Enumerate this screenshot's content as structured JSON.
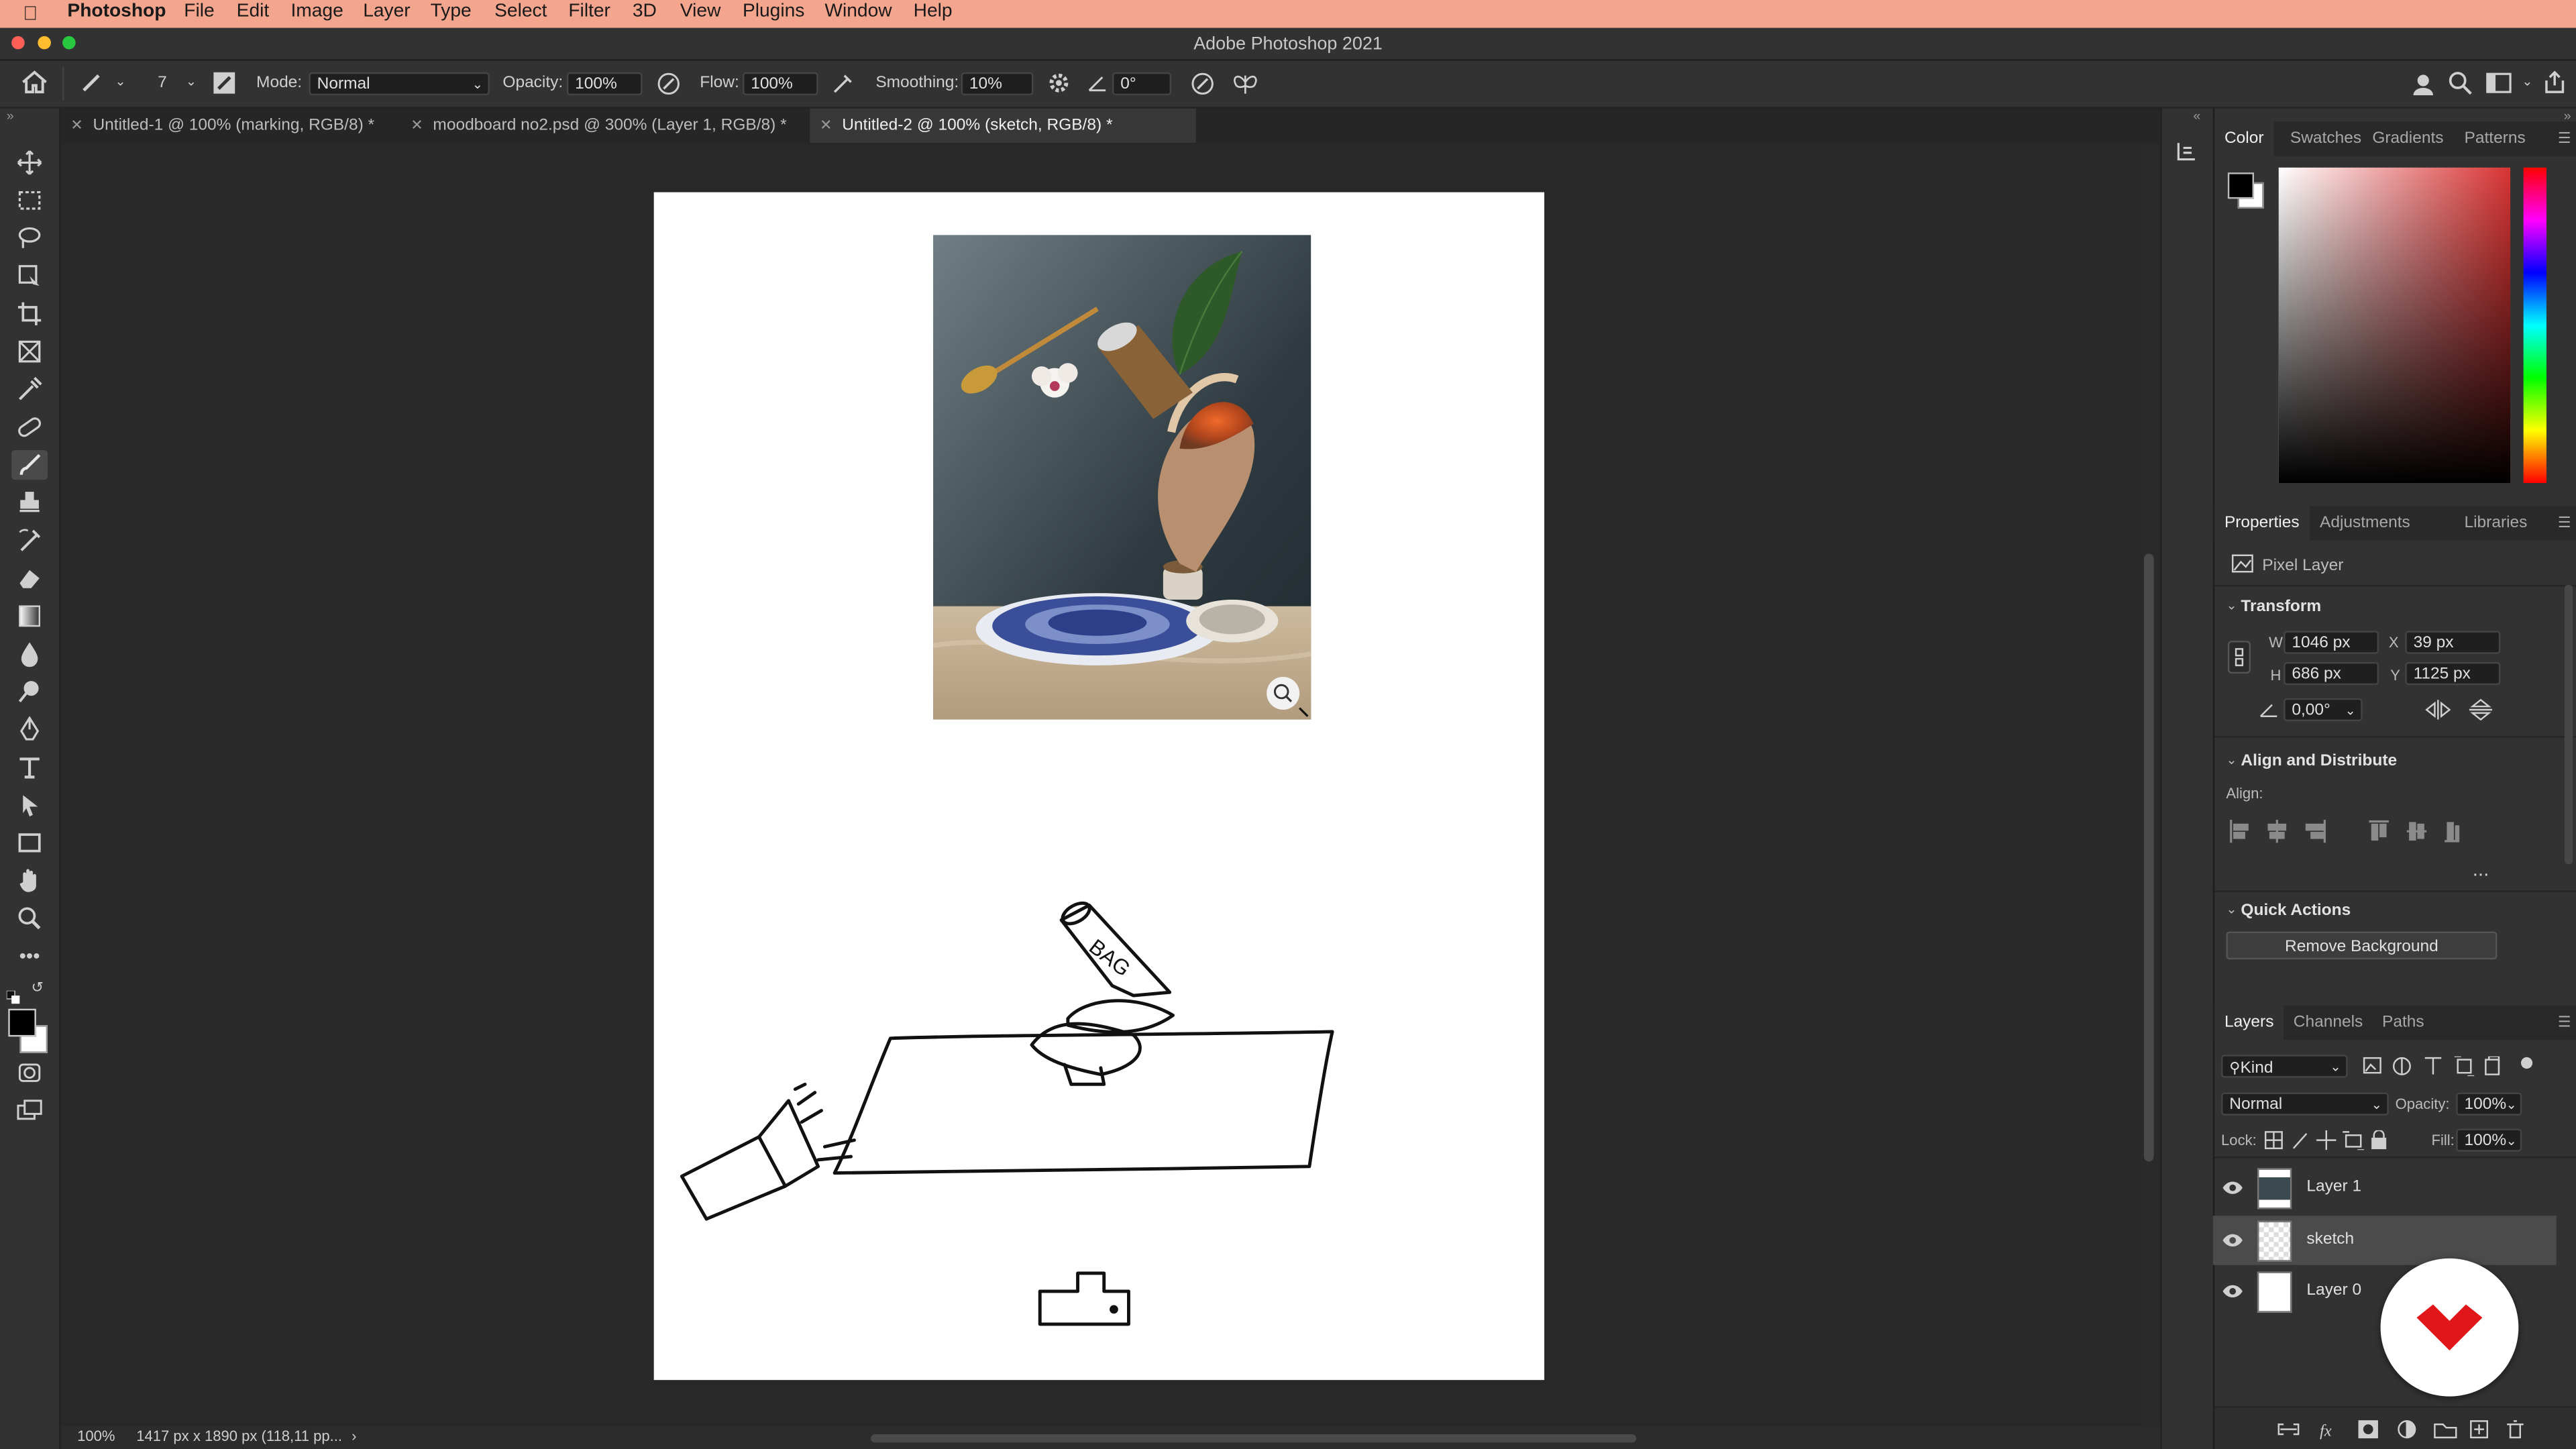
{
  "menubar": {
    "app": "Photoshop",
    "items": [
      "File",
      "Edit",
      "Image",
      "Layer",
      "Type",
      "Select",
      "Filter",
      "3D",
      "View",
      "Plugins",
      "Window",
      "Help"
    ]
  },
  "window": {
    "title": "Adobe Photoshop 2021"
  },
  "options": {
    "brush_size": "7",
    "mode_label": "Mode:",
    "mode_value": "Normal",
    "opacity_label": "Opacity:",
    "opacity_value": "100%",
    "flow_label": "Flow:",
    "flow_value": "100%",
    "smoothing_label": "Smoothing:",
    "smoothing_value": "10%",
    "angle_value": "0°"
  },
  "tabs": [
    {
      "label": "Untitled-1 @ 100% (marking, RGB/8) *"
    },
    {
      "label": "moodboard no2.psd @ 300% (Layer 1, RGB/8) *"
    },
    {
      "label": "Untitled-2 @ 100% (sketch, RGB/8) *"
    }
  ],
  "sketch": {
    "bag_text": "BAG"
  },
  "status": {
    "zoom": "100%",
    "dims": "1417 px x 1890 px (118,11 pp..."
  },
  "color_panel": {
    "tabs": [
      "Color",
      "Swatches",
      "Gradients",
      "Patterns"
    ],
    "foreground": "#000000",
    "background": "#ffffff",
    "accent": "#d93434"
  },
  "properties": {
    "tabs": [
      "Properties",
      "Adjustments",
      "Libraries"
    ],
    "layer_type": "Pixel Layer",
    "transform_title": "Transform",
    "w_label": "W",
    "w_value": "1046 px",
    "h_label": "H",
    "h_value": "686 px",
    "x_label": "X",
    "x_value": "39 px",
    "y_label": "Y",
    "y_value": "1125 px",
    "angle_value": "0,00°",
    "align_title": "Align and Distribute",
    "align_label": "Align:",
    "more": "...",
    "quick_actions_title": "Quick Actions",
    "remove_bg": "Remove Background"
  },
  "layers_panel": {
    "tabs": [
      "Layers",
      "Channels",
      "Paths"
    ],
    "kind": "Kind",
    "blend_mode": "Normal",
    "opacity_label": "Opacity:",
    "opacity_value": "100%",
    "lock_label": "Lock:",
    "fill_label": "Fill:",
    "fill_value": "100%",
    "layers": [
      {
        "name": "Layer 1",
        "selected": false
      },
      {
        "name": "sketch",
        "selected": true
      },
      {
        "name": "Layer 0",
        "selected": false
      }
    ]
  },
  "badge_color": "#e0161b"
}
